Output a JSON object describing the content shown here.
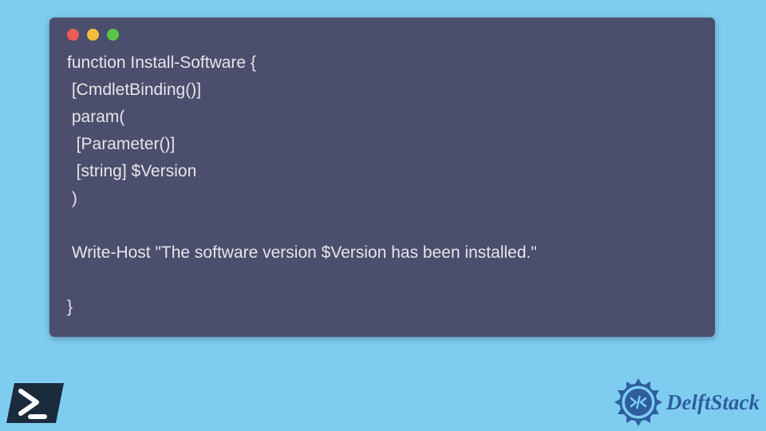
{
  "code": {
    "lines": [
      "function Install-Software {",
      " [CmdletBinding()]",
      " param(",
      "  [Parameter()]",
      "  [string] $Version",
      " )",
      "",
      " Write-Host \"The software version $Version has been installed.\"",
      "",
      "}"
    ]
  },
  "branding": {
    "name": "DelftStack"
  }
}
